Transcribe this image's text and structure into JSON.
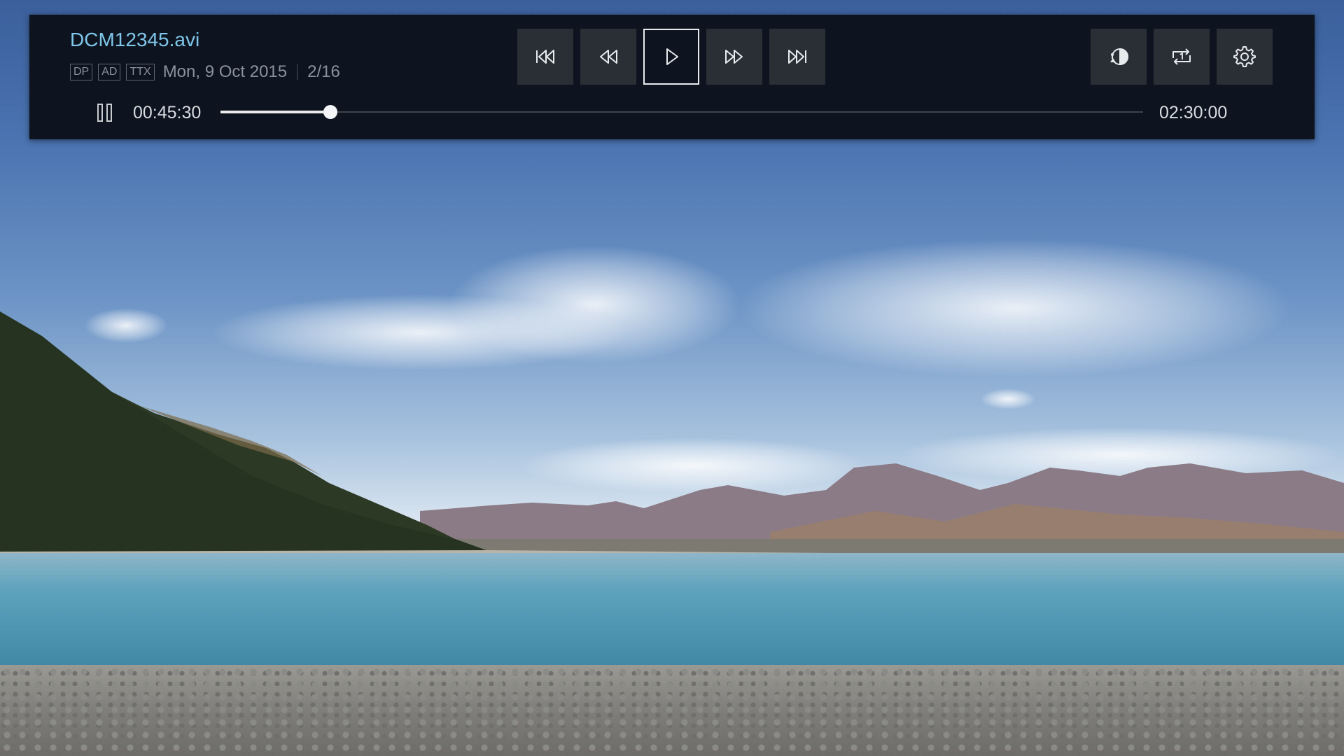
{
  "player": {
    "filename": "DCM12345.avi",
    "badges": [
      "DP",
      "AD",
      "TTX"
    ],
    "date": "Mon, 9 Oct 2015",
    "file_index": "2/16",
    "current_time": "00:45:30",
    "total_time": "02:30:00",
    "progress_fraction": 0.1192
  },
  "controls": [
    {
      "name": "skip-previous",
      "icon": "skip-previous-icon"
    },
    {
      "name": "rewind",
      "icon": "rewind-icon"
    },
    {
      "name": "play",
      "icon": "play-icon",
      "focused": true
    },
    {
      "name": "fast-forward",
      "icon": "fast-forward-icon"
    },
    {
      "name": "skip-next",
      "icon": "skip-next-icon"
    }
  ],
  "options": [
    {
      "name": "picture-mode",
      "icon": "picture-mode-icon"
    },
    {
      "name": "repeat-one",
      "icon": "repeat-one-icon"
    },
    {
      "name": "settings",
      "icon": "gear-icon"
    }
  ],
  "colors": {
    "panel_bg": "#0d141f",
    "button_bg": "#2a2f36",
    "filename_accent": "#7fc6ea",
    "progress_fill": "#e8eaec"
  }
}
